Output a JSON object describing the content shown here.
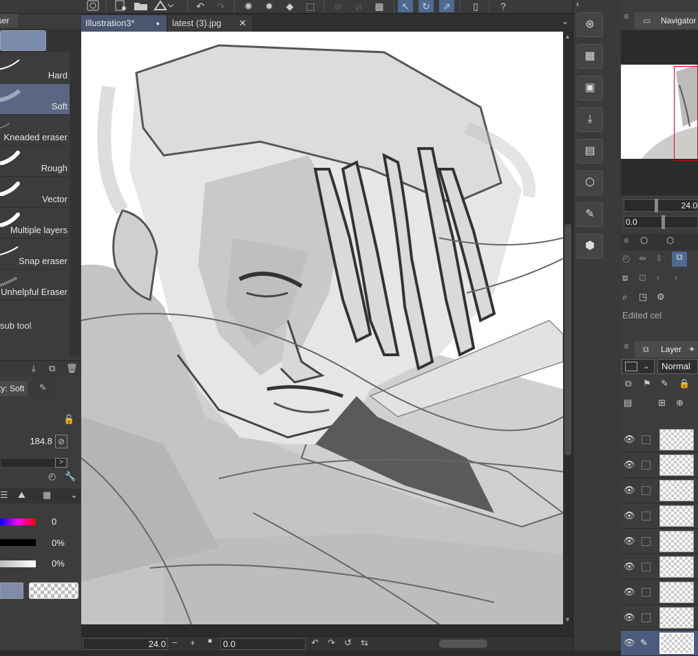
{
  "toolbar": {
    "icons": [
      "spiral-icon",
      "new-icon",
      "open-folder-icon",
      "export-icon",
      "undo-icon",
      "redo-icon",
      "loading-icon",
      "transform-icon",
      "fill-icon",
      "selection-icon",
      "deselect-icon",
      "snap-icon",
      "ruler-icon",
      "phone-icon",
      "help-icon"
    ]
  },
  "subtool": {
    "group_tab": "Eraser",
    "items": [
      {
        "label": "Hard"
      },
      {
        "label": "Soft"
      },
      {
        "label": "Kneaded eraser"
      },
      {
        "label": "Rough"
      },
      {
        "label": "Vector"
      },
      {
        "label": "Multiple layers"
      },
      {
        "label": "Snap eraser"
      },
      {
        "label": "Unhelpful Eraser"
      }
    ],
    "selected": "Soft",
    "add_label": "sub tool"
  },
  "tool_property": {
    "tab_label": "ty: Soft",
    "brush_size": "184.8",
    "color_values": [
      {
        "value": "0",
        "color": "hue"
      },
      {
        "value": "0%",
        "color": "black"
      },
      {
        "value": "0%",
        "color": "gray"
      }
    ]
  },
  "document_tabs": [
    {
      "label": "Illustration3*",
      "active": true,
      "marker": "●"
    },
    {
      "label": "latest (3).jpg",
      "active": false,
      "marker": "✕"
    }
  ],
  "canvas_bottom": {
    "zoom": "24.0",
    "angle": "0.0"
  },
  "navigator": {
    "title": "Navigator",
    "zoom": "24.0",
    "angle": "0.0"
  },
  "subview": {
    "status": "Edited cel"
  },
  "layer_panel": {
    "title": "Layer",
    "blend_mode": "Normal",
    "layers": [
      {
        "type": "transparent"
      },
      {
        "type": "transparent"
      },
      {
        "type": "transparent"
      },
      {
        "type": "transparent"
      },
      {
        "type": "transparent"
      },
      {
        "type": "transparent"
      },
      {
        "type": "transparent"
      },
      {
        "type": "transparent"
      },
      {
        "type": "sketch",
        "selected": true
      }
    ]
  }
}
